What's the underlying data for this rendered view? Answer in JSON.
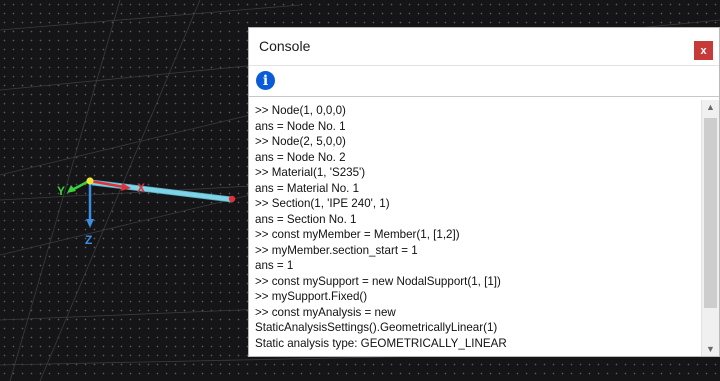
{
  "console": {
    "title": "Console",
    "close_label": "x",
    "info_icon": "info-icon",
    "lines": [
      ">> Node(1, 0,0,0)",
      "ans = Node No. 1",
      ">> Node(2, 5,0,0)",
      "ans = Node No. 2",
      ">> Material(1, 'S235')",
      "ans = Material No. 1",
      ">> Section(1, 'IPE 240', 1)",
      "ans = Section No. 1",
      ">> const myMember = Member(1, [1,2])",
      ">> myMember.section_start = 1",
      "ans = 1",
      ">> const mySupport = new NodalSupport(1, [1])",
      ">> mySupport.Fixed()",
      ">> const myAnalysis = new",
      "StaticAnalysisSettings().GeometricallyLinear(1)",
      "Static analysis type: GEOMETRICALLY_LINEAR"
    ]
  },
  "viewport": {
    "axis_labels": {
      "x": "X",
      "y": "Y",
      "z": "Z"
    },
    "colors": {
      "background": "#151517",
      "member": "#7fd3e6",
      "x_axis": "#e0303a",
      "y_axis": "#3ad13a",
      "z_axis": "#3a8fe0",
      "node_start": "#f0e43a",
      "node_end": "#e0303a"
    }
  }
}
